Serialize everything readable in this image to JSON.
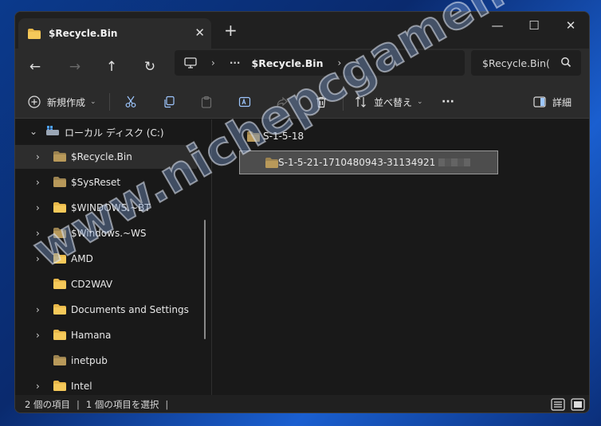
{
  "window": {
    "tab_title": "$Recycle.Bin",
    "new_tab_label": "+",
    "minimize_label": "—",
    "maximize_label": "☐",
    "close_label": "✕"
  },
  "address": {
    "segments": [
      "›",
      "···",
      "$Recycle.Bin",
      "›"
    ],
    "current": "$Recycle.Bin",
    "search_text": "$Recycle.Bin("
  },
  "toolbar": {
    "new_label": "新規作成",
    "sort_label": "並べ替え",
    "more_label": "···",
    "details_label": "詳細"
  },
  "nav": {
    "drive_label": "ローカル ディスク (C:)",
    "items": [
      {
        "label": "$Recycle.Bin",
        "selected": true,
        "expandable": true
      },
      {
        "label": "$SysReset",
        "selected": false,
        "expandable": true
      },
      {
        "label": "$WINDOWS.~BT",
        "selected": false,
        "expandable": true
      },
      {
        "label": "$Windows.~WS",
        "selected": false,
        "expandable": true
      },
      {
        "label": "AMD",
        "selected": false,
        "expandable": true
      },
      {
        "label": "CD2WAV",
        "selected": false,
        "expandable": false
      },
      {
        "label": "Documents and Settings",
        "selected": false,
        "expandable": true
      },
      {
        "label": "Hamana",
        "selected": false,
        "expandable": true
      },
      {
        "label": "inetpub",
        "selected": false,
        "expandable": false
      },
      {
        "label": "Intel",
        "selected": false,
        "expandable": true
      }
    ]
  },
  "content": {
    "files": [
      {
        "name": "S-1-5-18",
        "selected": false
      },
      {
        "name": "S-1-5-21-1710480943-31134921",
        "selected": true
      }
    ]
  },
  "status": {
    "item_count": "2 個の項目",
    "selected_count": "1 個の項目を選択"
  },
  "watermark": "www.nichepcgamer.com",
  "colors": {
    "folder": "#d8ae55",
    "window_bg": "#191919",
    "bar_bg": "#2b2b2b"
  }
}
